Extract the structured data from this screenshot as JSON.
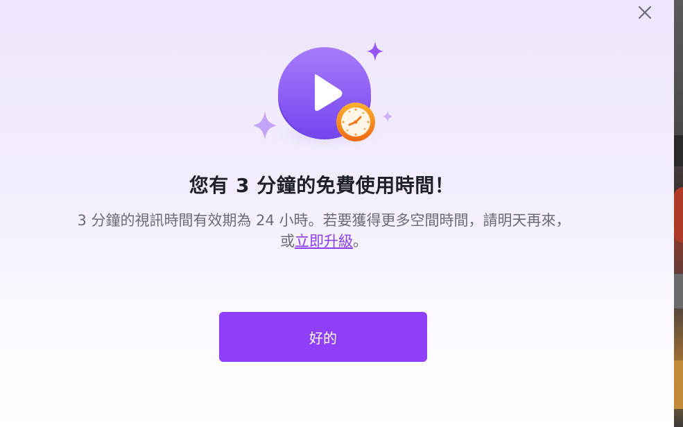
{
  "dialog": {
    "title": "您有 3 分鐘的免費使用時間！",
    "description_before": "3 分鐘的視訊時間有效期為 24 小時。若要獲得更多空間時間，請明天再來，或",
    "upgrade_link": "立即升級",
    "description_after": "。",
    "ok_button": "好的",
    "close_icon": "close-icon",
    "illustration_icons": [
      "play-icon",
      "clock-icon",
      "sparkle-icon"
    ]
  },
  "colors": {
    "accent": "#8e3ff7",
    "link": "#8a3cf5",
    "title": "#1f1f2b",
    "text": "#6b6b78",
    "clock": "#f07a1a"
  }
}
